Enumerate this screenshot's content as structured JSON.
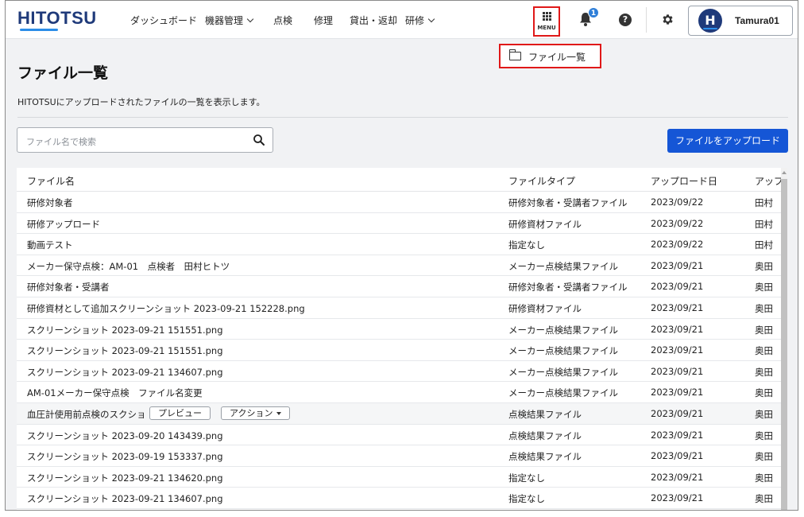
{
  "app": {
    "logo": "HITOTSU"
  },
  "nav": {
    "dashboard": "ダッシュボード",
    "equipment": "機器管理",
    "inspection": "点検",
    "repair": "修理",
    "lending": "貸出・返却",
    "training": "研修"
  },
  "header": {
    "menu_label": "MENU",
    "notification_count": "1",
    "help_label": "?",
    "avatar_letter": "H",
    "username": "Tamura01"
  },
  "dropdown": {
    "file_list_label": "ファイル一覧"
  },
  "page": {
    "title": "ファイル一覧",
    "description": "HITOTSUにアップロードされたファイルの一覧を表示します。"
  },
  "search": {
    "placeholder": "ファイル名で検索"
  },
  "upload_button": "ファイルをアップロード",
  "table": {
    "columns": [
      "ファイル名",
      "ファイルタイプ",
      "アップロード日",
      "アップ"
    ],
    "rows": [
      {
        "name": "研修対象者",
        "type": "研修対象者・受講者ファイル",
        "date": "2023/09/22",
        "uploader": "田村"
      },
      {
        "name": "研修アップロード",
        "type": "研修資材ファイル",
        "date": "2023/09/22",
        "uploader": "田村"
      },
      {
        "name": "動画テスト",
        "type": "指定なし",
        "date": "2023/09/22",
        "uploader": "田村"
      },
      {
        "name": "メーカー保守点検：AM-01　点検者　田村ヒトツ",
        "type": "メーカー点検結果ファイル",
        "date": "2023/09/21",
        "uploader": "奥田"
      },
      {
        "name": "研修対象者・受講者",
        "type": "研修対象者・受講者ファイル",
        "date": "2023/09/21",
        "uploader": "奥田"
      },
      {
        "name": "研修資材として追加スクリーンショット 2023-09-21 152228.png",
        "type": "研修資材ファイル",
        "date": "2023/09/21",
        "uploader": "奥田"
      },
      {
        "name": "スクリーンショット 2023-09-21 151551.png",
        "type": "メーカー点検結果ファイル",
        "date": "2023/09/21",
        "uploader": "奥田"
      },
      {
        "name": "スクリーンショット 2023-09-21 151551.png",
        "type": "メーカー点検結果ファイル",
        "date": "2023/09/21",
        "uploader": "奥田"
      },
      {
        "name": "スクリーンショット 2023-09-21 134607.png",
        "type": "メーカー点検結果ファイル",
        "date": "2023/09/21",
        "uploader": "奥田"
      },
      {
        "name": "AM-01メーカー保守点検　ファイル名変更",
        "type": "メーカー点検結果ファイル",
        "date": "2023/09/21",
        "uploader": "奥田"
      },
      {
        "name": "血圧計使用前点検のスクショ",
        "type": "点検結果ファイル",
        "date": "2023/09/21",
        "uploader": "奥田",
        "preview_label": "プレビュー",
        "action_label": "アクション"
      },
      {
        "name": "スクリーンショット 2023-09-20 143439.png",
        "type": "点検結果ファイル",
        "date": "2023/09/21",
        "uploader": "奥田"
      },
      {
        "name": "スクリーンショット 2023-09-19 153337.png",
        "type": "点検結果ファイル",
        "date": "2023/09/21",
        "uploader": "奥田"
      },
      {
        "name": "スクリーンショット 2023-09-21 134620.png",
        "type": "指定なし",
        "date": "2023/09/21",
        "uploader": "奥田"
      },
      {
        "name": "スクリーンショット 2023-09-21 134607.png",
        "type": "指定なし",
        "date": "2023/09/21",
        "uploader": "奥田"
      }
    ]
  },
  "colors": {
    "brand_navy": "#1f3a7a",
    "brand_accent": "#2b8de8",
    "primary_button": "#1556d6",
    "highlight_box": "#e01818",
    "badge": "#2f7fd8"
  },
  "icons": {
    "menu": "grid-icon",
    "notification": "bell-icon",
    "help": "help-icon",
    "settings": "gear-icon",
    "search": "search-icon",
    "folder": "folder-icon",
    "caret": "caret-down-icon"
  }
}
